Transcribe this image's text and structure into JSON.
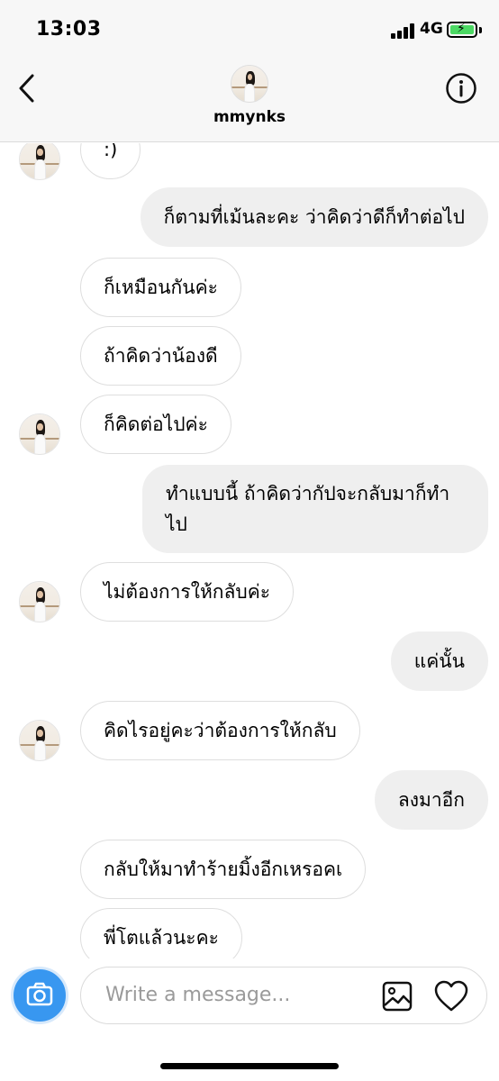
{
  "status": {
    "time": "13:03",
    "network": "4G",
    "battery_state": "charging"
  },
  "header": {
    "username": "mmynks",
    "back_icon": "chevron-left-icon",
    "info_icon": "info-icon"
  },
  "messages": [
    {
      "direction": "incoming",
      "text": ":)"
    },
    {
      "direction": "outgoing",
      "text": "ก็ตามที่เม้นละคะ ว่าคิดว่าดีก็ทำต่อไป"
    },
    {
      "direction": "incoming",
      "text": "ก็เหมือนกันค่ะ"
    },
    {
      "direction": "incoming",
      "text": "ถ้าคิดว่าน้องดี"
    },
    {
      "direction": "incoming",
      "text": "ก็คิดต่อไปค่ะ"
    },
    {
      "direction": "outgoing",
      "text": "ทำแบบนี้ ถ้าคิดว่ากัปจะกลับมาก็ทำ",
      "text2": "ไป"
    },
    {
      "direction": "incoming",
      "text": "ไม่ต้องการให้กลับค่ะ"
    },
    {
      "direction": "outgoing",
      "text": "แค่นั้น"
    },
    {
      "direction": "incoming",
      "text": "คิดไรอยู่คะว่าต้องการให้กลับ"
    },
    {
      "direction": "outgoing",
      "text": "ลงมาอีก"
    },
    {
      "direction": "incoming",
      "text": "กลับให้มาทำร้ายมิ้งอีกเหรอคเ"
    },
    {
      "direction": "incoming",
      "text": "พี่โตแล้วนะคะ"
    }
  ],
  "composer": {
    "placeholder": "Write a message...",
    "camera_icon": "camera-icon",
    "gallery_icon": "gallery-icon",
    "like_icon": "heart-icon",
    "camera_color": "#3897f0"
  }
}
